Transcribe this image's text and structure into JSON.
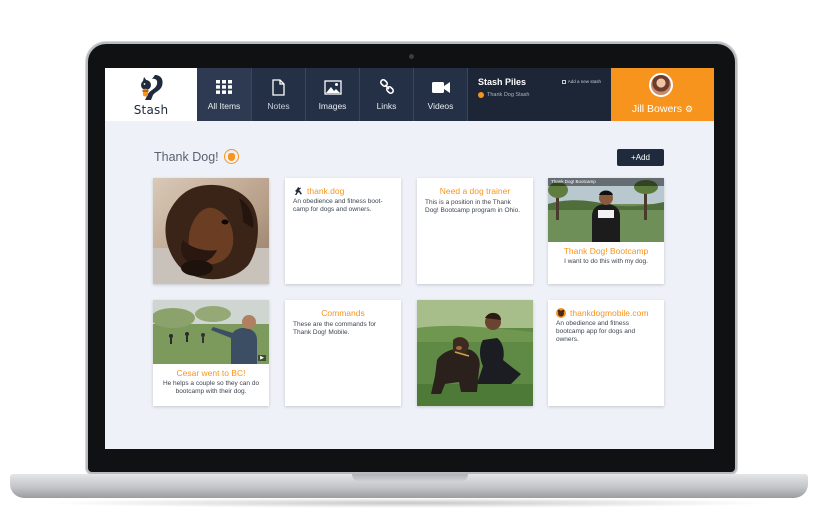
{
  "app": {
    "name": "Stash",
    "colors": {
      "brand_navy": "#1f2a3c",
      "accent_orange": "#f7941d",
      "content_bg": "#eef2f8"
    }
  },
  "nav": {
    "tabs": [
      {
        "label": "All Items",
        "icon": "grid-icon",
        "active": true
      },
      {
        "label": "Notes",
        "icon": "document-icon"
      },
      {
        "label": "Images",
        "icon": "image-icon"
      },
      {
        "label": "Links",
        "icon": "chain-link-icon"
      },
      {
        "label": "Videos",
        "icon": "video-camera-icon"
      }
    ]
  },
  "piles": {
    "title": "Stash Piles",
    "add_label": "Add a new stash",
    "items": [
      {
        "label": "Thank Dog Stash"
      }
    ]
  },
  "user": {
    "name": "Jill Bowers",
    "settings_icon": "gear-icon"
  },
  "page": {
    "title": "Thank Dog!",
    "add_label": "+Add"
  },
  "cards": [
    {
      "type": "image",
      "description_icon": "dog-photo"
    },
    {
      "type": "link",
      "title": "thank.dog",
      "body": "An obedience and fitness boot-camp for dogs and owners.",
      "favicon": "running-dog-icon"
    },
    {
      "type": "note",
      "title": "Need a dog trainer",
      "body": "This is a position in the Thank Dog! Bootcamp program in Ohio."
    },
    {
      "type": "video",
      "title": "Thank Dog! Bootcamp",
      "body": "I want to do this with my dog.",
      "bar_text": "Thank Dog! Bootcamp"
    },
    {
      "type": "video",
      "title": "Cesar went to BC!",
      "body": "He helps a couple so they can do bootcamp with their dog."
    },
    {
      "type": "note",
      "title": "Commands",
      "body": "These are the commands for Thank Dog! Mobile."
    },
    {
      "type": "image",
      "description_icon": "woman-and-dog-photo"
    },
    {
      "type": "link",
      "title": "thankdogmobile.com",
      "body": "An obedience and fitness bootcamp app for dogs and owners.",
      "favicon": "dog-badge-icon"
    }
  ]
}
